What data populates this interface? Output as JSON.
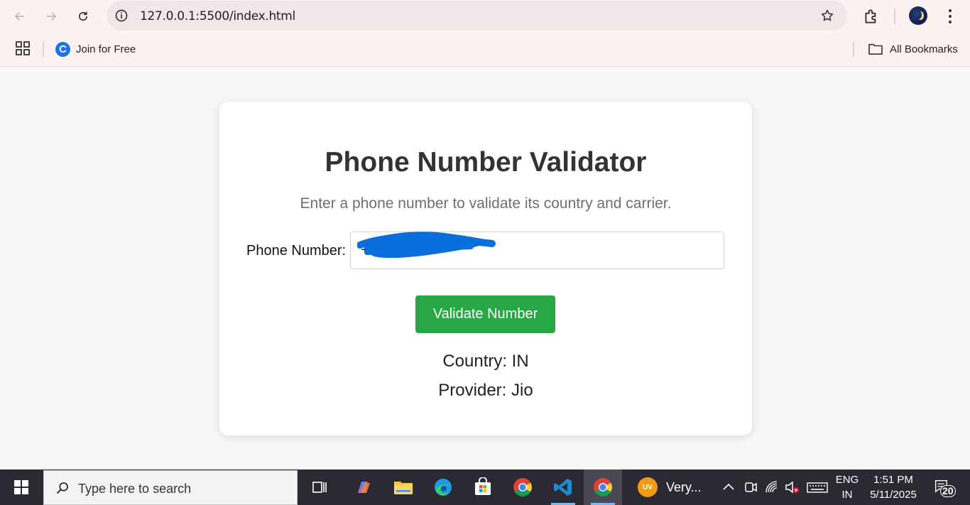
{
  "browser": {
    "url": "127.0.0.1:5500/index.html",
    "bookmark_label": "Join for Free",
    "bookmark_logo_letter": "C",
    "all_bookmarks_label": "All Bookmarks"
  },
  "app": {
    "title": "Phone Number Validator",
    "subtitle": "Enter a phone number to validate its country and carrier.",
    "phone_label": "Phone Number:",
    "phone_value": "+9",
    "button_label": "Validate Number",
    "country_result": "Country: IN",
    "provider_result": "Provider: Jio"
  },
  "taskbar": {
    "search_placeholder": "Type here to search",
    "running_app_label": "Very...",
    "running_app_badge": "UV",
    "language_line1": "ENG",
    "language_line2": "IN",
    "time": "1:51 PM",
    "date": "5/11/2025",
    "notification_count": "20"
  },
  "colors": {
    "accent_green": "#28a745",
    "title_color": "#333333",
    "redaction_blue": "#0a6fdc"
  }
}
